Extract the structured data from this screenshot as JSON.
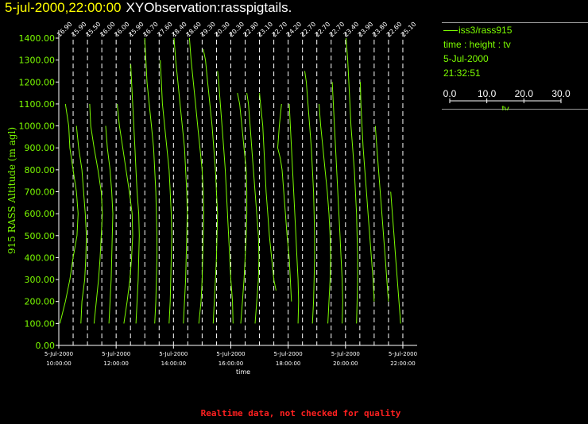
{
  "header": {
    "datetime": "5-jul-2000,22:00:00",
    "observation": "XYObservation:rasspigtails."
  },
  "legend": {
    "series": "iss3/rass915",
    "mode": "time : height : tv",
    "date": "5-Jul-2000",
    "time": "21:32:51",
    "scale_ticks": [
      "0.0",
      "10.0",
      "20.0",
      "30.0"
    ],
    "scale_label": "tv",
    "line_color": "#7cfc00"
  },
  "footer": {
    "note": "Realtime data, not checked for quality"
  },
  "chart_data": {
    "type": "line",
    "title": "",
    "ylabel": "915 RASS Altitude (m agl)",
    "xlabel": "time",
    "ylim": [
      0,
      1400
    ],
    "yticks": [
      "0.00",
      "100.00",
      "200.00",
      "300.00",
      "400.00",
      "500.00",
      "600.00",
      "700.00",
      "800.00",
      "900.00",
      "1000.00",
      "1100.00",
      "1200.00",
      "1300.00",
      "1400.00"
    ],
    "xlim": [
      "2000-07-05 10:00",
      "2000-07-05 22:30"
    ],
    "xticks": [
      {
        "time": "2000-07-05 10:00",
        "date": "5-Jul-2000",
        "clock": "10:00:00"
      },
      {
        "time": "2000-07-05 12:00",
        "date": "5-Jul-2000",
        "clock": "12:00:00"
      },
      {
        "time": "2000-07-05 14:00",
        "date": "5-Jul-2000",
        "clock": "14:00:00"
      },
      {
        "time": "2000-07-05 16:00",
        "date": "5-Jul-2000",
        "clock": "16:00:00"
      },
      {
        "time": "2000-07-05 18:00",
        "date": "5-Jul-2000",
        "clock": "18:00:00"
      },
      {
        "time": "2000-07-05 20:00",
        "date": "5-Jul-2000",
        "clock": "20:00:00"
      },
      {
        "time": "2000-07-05 22:00",
        "date": "5-Jul-2000",
        "clock": "22:00:00"
      }
    ],
    "profile_scale_per_hour": 26,
    "grid": false,
    "series": [
      {
        "time": "2000-07-05 10:00",
        "label": "16.90",
        "tv": [
          1.0,
          6.0,
          10.0,
          13.0,
          16.5,
          17.5,
          16.0,
          13.0,
          10.0,
          9.0,
          6.0
        ],
        "alt": [
          100,
          200,
          300,
          400,
          500,
          600,
          700,
          800,
          900,
          1000,
          1100
        ]
      },
      {
        "time": "2000-07-05 10:30",
        "label": "15.90",
        "tv": [
          7.0,
          8.0,
          10.5,
          11.5,
          12.0,
          11.0,
          9.5,
          8.0,
          5.0,
          3.0
        ],
        "alt": [
          100,
          200,
          300,
          400,
          500,
          600,
          700,
          800,
          900,
          1000
        ]
      },
      {
        "time": "2000-07-05 11:00",
        "label": "15.50",
        "tv": [
          6.0,
          8.0,
          10.0,
          11.5,
          12.5,
          13.5,
          12.5,
          9.5,
          6.0,
          3.0,
          2.0
        ],
        "alt": [
          100,
          200,
          300,
          400,
          500,
          600,
          700,
          800,
          900,
          1000,
          1100
        ]
      },
      {
        "time": "2000-07-05 11:30",
        "label": "16.00",
        "tv": [
          6.5,
          7.5,
          8.5,
          9.0,
          9.5,
          10.0,
          9.0,
          7.5,
          5.0,
          3.5
        ],
        "alt": [
          100,
          200,
          300,
          400,
          500,
          600,
          700,
          800,
          900,
          1000
        ]
      },
      {
        "time": "2000-07-05 12:00",
        "label": "16.00",
        "tv": [
          7.0,
          10.0,
          12.5,
          14.0,
          15.0,
          14.5,
          12.0,
          9.0,
          6.0,
          3.0,
          1.0
        ],
        "alt": [
          100,
          200,
          300,
          400,
          500,
          600,
          700,
          800,
          900,
          1000,
          1100
        ]
      },
      {
        "time": "2000-07-05 12:30",
        "label": "15.90",
        "tv": [
          5.0,
          6.0,
          7.0,
          7.5,
          8.0,
          7.5,
          6.0,
          5.0,
          4.0,
          3.0,
          2.0,
          1.0,
          0.5,
          0.3
        ],
        "alt": [
          100,
          200,
          300,
          400,
          500,
          600,
          700,
          800,
          900,
          1000,
          1100,
          1200,
          1250,
          1280
        ]
      },
      {
        "time": "2000-07-05 13:00",
        "label": "16.70",
        "tv": [
          9.0,
          10.0,
          10.5,
          11.0,
          11.0,
          10.5,
          10.0,
          9.0,
          8.0,
          6.0,
          4.0,
          2.0,
          1.0,
          0.0
        ],
        "alt": [
          100,
          200,
          300,
          400,
          500,
          600,
          700,
          800,
          900,
          1000,
          1100,
          1200,
          1300,
          1400
        ]
      },
      {
        "time": "2000-07-05 13:30",
        "label": "17.60",
        "tv": [
          9.0,
          10.0,
          10.5,
          11.0,
          11.5,
          11.0,
          10.0,
          9.0,
          7.0,
          5.0,
          3.0,
          2.0,
          1.0
        ],
        "alt": [
          100,
          200,
          300,
          400,
          500,
          600,
          700,
          800,
          900,
          1000,
          1100,
          1200,
          1300
        ]
      },
      {
        "time": "2000-07-05 14:00",
        "label": "18.40",
        "tv": [
          9.0,
          10.0,
          11.0,
          11.5,
          12.0,
          12.5,
          12.0,
          11.0,
          10.0,
          8.0,
          6.0,
          4.0,
          2.0,
          0.5
        ],
        "alt": [
          100,
          200,
          300,
          400,
          500,
          600,
          700,
          800,
          900,
          1000,
          1100,
          1200,
          1300,
          1400
        ]
      },
      {
        "time": "2000-07-05 14:30",
        "label": "18.60",
        "tv": [
          10.0,
          12.0,
          13.0,
          13.5,
          14.0,
          14.5,
          14.0,
          13.0,
          11.0,
          9.0,
          7.0,
          5.0,
          3.0,
          1.5
        ],
        "alt": [
          100,
          200,
          300,
          400,
          500,
          600,
          700,
          800,
          900,
          1000,
          1100,
          1200,
          1300,
          1400
        ]
      },
      {
        "time": "2000-07-05 15:00",
        "label": "19.30",
        "tv": [
          10.0,
          11.0,
          12.0,
          13.0,
          13.5,
          14.0,
          13.0,
          12.0,
          10.5,
          9.0,
          7.0,
          5.0,
          3.0,
          1.0
        ],
        "alt": [
          100,
          200,
          300,
          400,
          500,
          600,
          700,
          800,
          900,
          1000,
          1100,
          1200,
          1300,
          1350
        ]
      },
      {
        "time": "2000-07-05 15:30",
        "label": "20.30",
        "tv": [
          15.0,
          14.5,
          13.0,
          12.0,
          11.0,
          10.0,
          9.0,
          8.0,
          6.5,
          5.0,
          3.5,
          2.0,
          1.0
        ],
        "alt": [
          100,
          200,
          300,
          400,
          500,
          600,
          700,
          800,
          900,
          1000,
          1100,
          1200,
          1250
        ]
      },
      {
        "time": "2000-07-05 16:00",
        "label": "20.30",
        "tv": [
          9.0,
          10.5,
          12.0,
          13.0,
          14.0,
          14.5,
          14.5,
          14.0,
          12.0,
          10.0,
          8.0,
          6.0
        ],
        "alt": [
          100,
          200,
          300,
          400,
          500,
          600,
          700,
          800,
          900,
          1000,
          1100,
          1150
        ]
      },
      {
        "time": "2000-07-05 16:30",
        "label": "22.80",
        "tv": [
          9.0,
          10.5,
          12.0,
          12.5,
          12.0,
          10.5,
          9.0,
          7.5,
          6.0,
          4.5,
          3.0,
          1.5
        ],
        "alt": [
          100,
          200,
          300,
          400,
          500,
          600,
          700,
          800,
          900,
          1000,
          1100,
          1150
        ]
      },
      {
        "time": "2000-07-05 17:00",
        "label": "23.10",
        "tv": [
          15.0,
          13.0,
          11.0,
          9.0,
          7.5,
          6.0,
          5.0,
          4.0,
          3.0,
          2.0,
          1.0,
          0.0
        ],
        "alt": [
          250,
          300,
          400,
          500,
          600,
          700,
          800,
          900,
          1000,
          1050,
          1100,
          1150
        ]
      },
      {
        "time": "2000-07-05 17:30",
        "label": "22.70",
        "tv": [
          16.0,
          15.0,
          14.0,
          12.0,
          10.5,
          9.0,
          7.5,
          6.0,
          3.5,
          5.0,
          7.0
        ],
        "alt": [
          200,
          300,
          400,
          500,
          600,
          700,
          800,
          850,
          900,
          1000,
          1100
        ]
      },
      {
        "time": "2000-07-05 18:00",
        "label": "24.20",
        "tv": [
          9.0,
          9.5,
          9.0,
          8.0,
          7.0,
          6.0,
          5.0,
          4.0,
          3.0,
          2.0,
          1.0
        ],
        "alt": [
          100,
          200,
          300,
          400,
          500,
          600,
          700,
          800,
          900,
          1000,
          1100
        ]
      },
      {
        "time": "2000-07-05 18:30",
        "label": "22.70",
        "tv": [
          9.0,
          10.0,
          10.5,
          11.0,
          11.0,
          10.5,
          10.0,
          9.0,
          8.0,
          6.5,
          5.0,
          3.5,
          2.0
        ],
        "alt": [
          100,
          200,
          300,
          400,
          500,
          600,
          700,
          800,
          900,
          1000,
          1100,
          1200,
          1250
        ]
      },
      {
        "time": "2000-07-05 19:00",
        "label": "22.70",
        "tv": [
          10.0,
          11.0,
          12.0,
          12.5,
          12.0,
          11.0,
          9.5,
          7.5,
          5.5,
          3.5,
          2.0
        ],
        "alt": [
          100,
          200,
          300,
          400,
          500,
          600,
          700,
          800,
          900,
          1000,
          1100
        ]
      },
      {
        "time": "2000-07-05 19:30",
        "label": "22.70",
        "tv": [
          10.0,
          10.5,
          10.0,
          9.0,
          8.0,
          7.0,
          6.0,
          5.0,
          4.0,
          3.0,
          2.0,
          1.0
        ],
        "alt": [
          100,
          200,
          300,
          400,
          500,
          600,
          700,
          800,
          900,
          1000,
          1100,
          1200
        ]
      },
      {
        "time": "2000-07-05 20:00",
        "label": "23.40",
        "tv": [
          10.0,
          10.5,
          11.0,
          11.0,
          10.5,
          10.0,
          9.0,
          8.0,
          6.5,
          5.0,
          4.0,
          3.0,
          2.0,
          0.5
        ],
        "alt": [
          100,
          200,
          300,
          400,
          500,
          600,
          700,
          800,
          900,
          1000,
          1100,
          1200,
          1300,
          1400
        ]
      },
      {
        "time": "2000-07-05 20:30",
        "label": "23.90",
        "tv": [
          13.0,
          12.0,
          10.5,
          9.0,
          7.5,
          6.0,
          4.5,
          3.0,
          2.0,
          1.0,
          0.5
        ],
        "alt": [
          200,
          300,
          400,
          500,
          600,
          700,
          800,
          900,
          1000,
          1100,
          1200
        ]
      },
      {
        "time": "2000-07-05 21:00",
        "label": "23.80",
        "tv": [
          13.0,
          11.5,
          10.0,
          8.5,
          7.0,
          5.5,
          4.0,
          2.5,
          1.0
        ],
        "alt": [
          200,
          300,
          400,
          500,
          600,
          700,
          800,
          900,
          1000
        ]
      },
      {
        "time": "2000-07-05 21:30",
        "label": "22.60",
        "tv": [
          11.0,
          9.5,
          8.0,
          6.5,
          5.0,
          3.5,
          2.0
        ],
        "alt": [
          100,
          200,
          300,
          400,
          500,
          600,
          700
        ]
      },
      {
        "time": "2000-07-05 22:00",
        "label": "25.10",
        "tv": [],
        "alt": []
      }
    ]
  }
}
